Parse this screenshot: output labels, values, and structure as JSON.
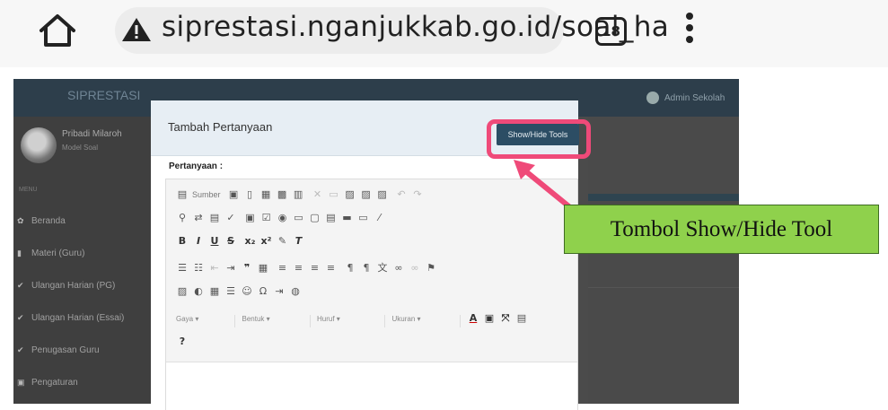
{
  "browser": {
    "url": "siprestasi.nganjukkab.go.id/soal_ha",
    "tab_count": "18",
    "icons": [
      "home-icon",
      "warning-icon",
      "more-vert-icon"
    ]
  },
  "app": {
    "brand": "SIPRESTASI",
    "user_name": "Admin Sekolah",
    "profile": {
      "name": "Pribadi Milaroh",
      "role": "Model Soal"
    },
    "menu_header": "MENU",
    "nav": [
      {
        "icon": "dashboard-icon",
        "label": "Beranda"
      },
      {
        "icon": "book-icon",
        "label": "Materi (Guru)"
      },
      {
        "icon": "check-icon",
        "label": "Ulangan Harian (PG)"
      },
      {
        "icon": "check-icon",
        "label": "Ulangan Harian (Essai)"
      },
      {
        "icon": "check-icon",
        "label": "Penugasan Guru"
      },
      {
        "icon": "settings-icon",
        "label": "Pengaturan"
      }
    ]
  },
  "modal": {
    "title": "Tambah Pertanyaan",
    "toggle_label": "Show/Hide Tools",
    "field_label": "Pertanyaan :",
    "toolbar": {
      "source_label": "Sumber",
      "style_label": "Gaya",
      "format_label": "Bentuk",
      "font_label": "Huruf",
      "size_label": "Ukuran",
      "help_label": "?"
    }
  },
  "annotation": {
    "label": "Tombol Show/Hide Tool",
    "highlight_color": "#ef4a79",
    "callout_color": "#8fd14c"
  }
}
